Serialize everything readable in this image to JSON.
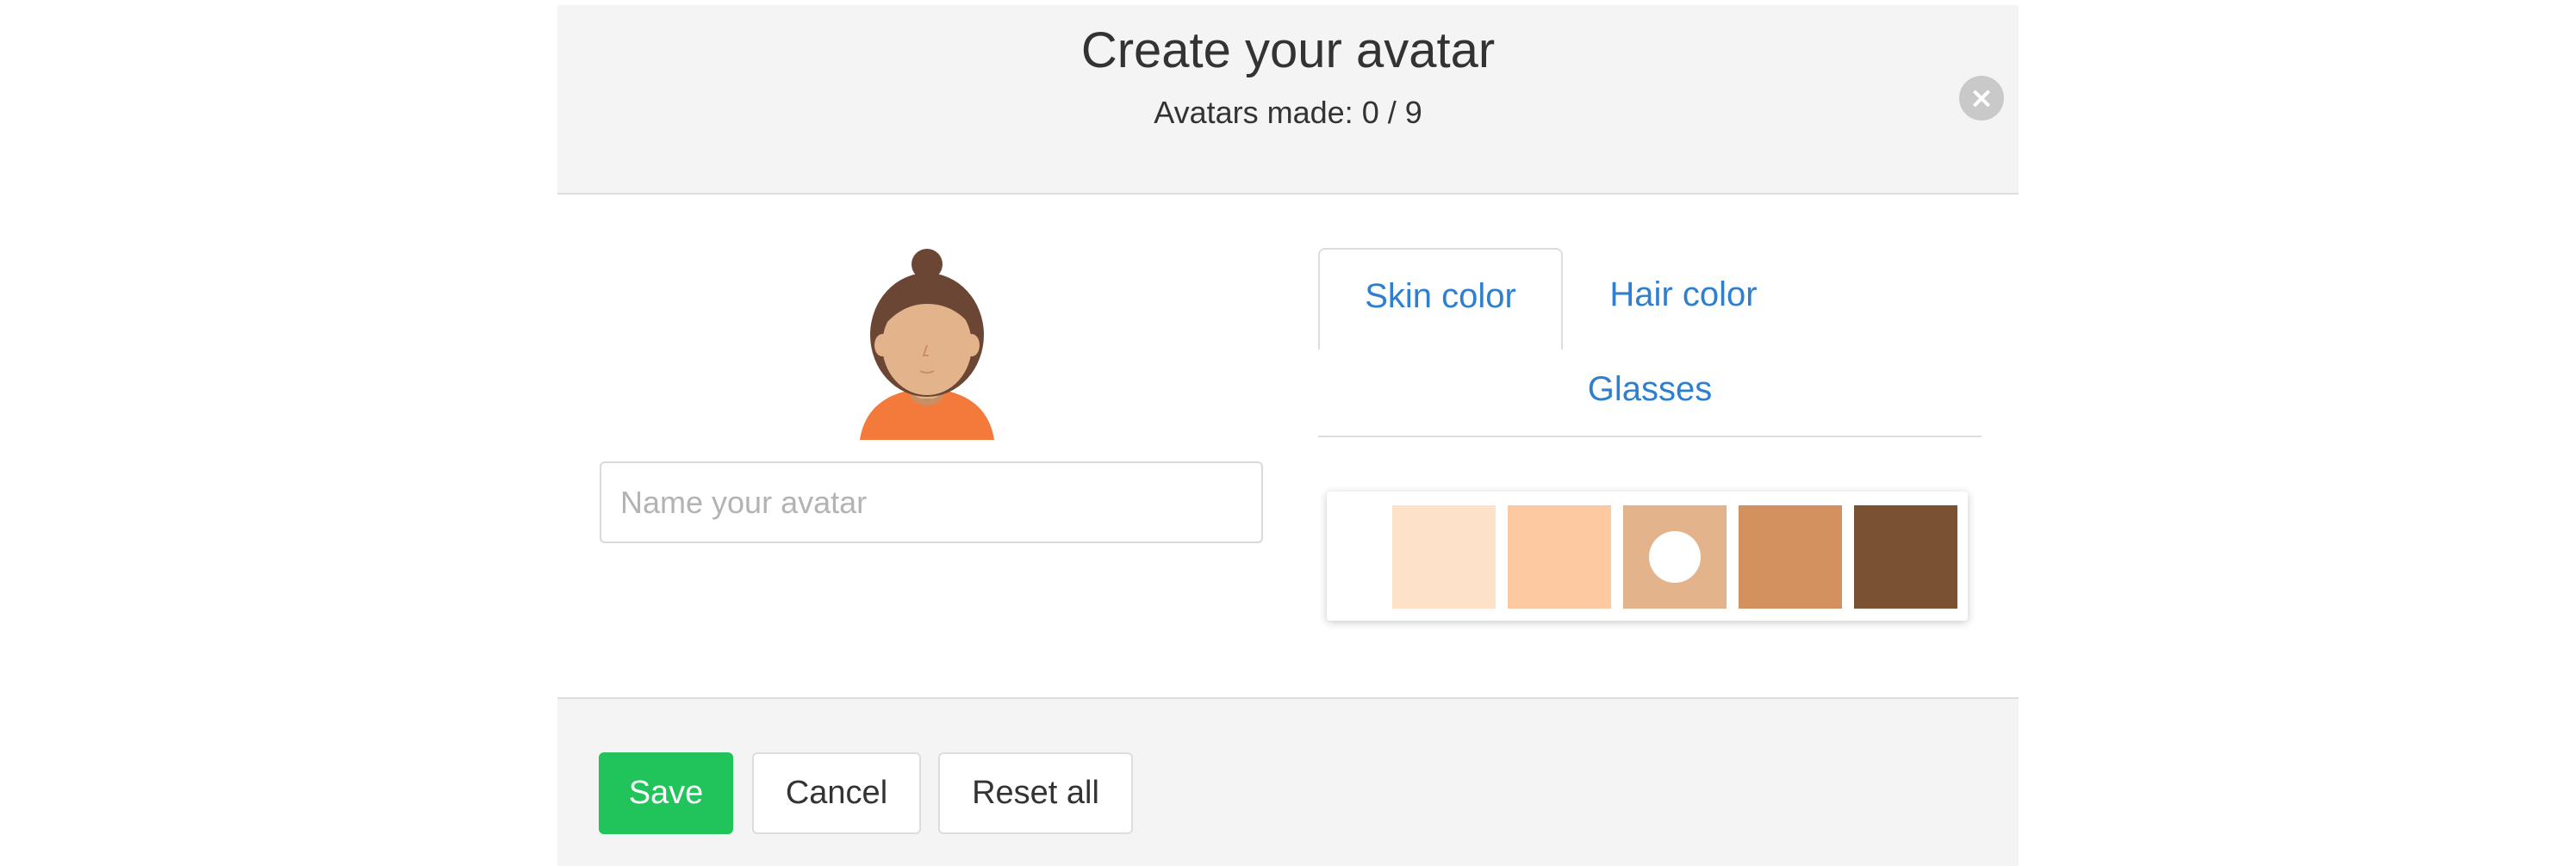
{
  "header": {
    "title": "Create your avatar",
    "subtitle": "Avatars made: 0 / 9",
    "close_icon": "close-icon"
  },
  "avatar": {
    "icon": "avatar-preview",
    "skin_color": "#e3b48c",
    "hair_color": "#6b4634",
    "shirt_color": "#f47a3c"
  },
  "name_input": {
    "value": "",
    "placeholder": "Name your avatar"
  },
  "tabs": [
    {
      "label": "Skin color",
      "active": true
    },
    {
      "label": "Hair color",
      "active": false
    },
    {
      "label": "Glasses",
      "active": false
    }
  ],
  "skin_swatches": [
    {
      "color": "#ffffff",
      "selected": false
    },
    {
      "color": "#fde1c9",
      "selected": false
    },
    {
      "color": "#fcc9a1",
      "selected": false
    },
    {
      "color": "#e3b48c",
      "selected": true
    },
    {
      "color": "#d3915f",
      "selected": false
    },
    {
      "color": "#7a5232",
      "selected": false
    }
  ],
  "footer": {
    "save_label": "Save",
    "cancel_label": "Cancel",
    "reset_label": "Reset all"
  },
  "colors": {
    "accent_link": "#2f7fd0",
    "save_green": "#21c45a"
  }
}
